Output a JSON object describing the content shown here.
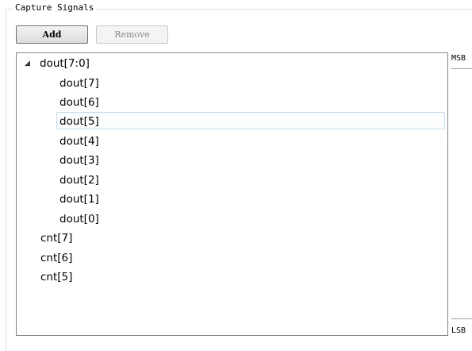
{
  "group": {
    "title": "Capture Signals"
  },
  "buttons": {
    "add": "Add",
    "remove": "Remove"
  },
  "tree": {
    "expander_glyph": "◢",
    "parent": "dout[7:0]",
    "children": [
      "dout[7]",
      "dout[6]",
      "dout[5]",
      "dout[4]",
      "dout[3]",
      "dout[2]",
      "dout[1]",
      "dout[0]"
    ],
    "selected": "dout[5]",
    "siblings": [
      "cnt[7]",
      "cnt[6]",
      "cnt[5]"
    ]
  },
  "axis": {
    "top": "MSB",
    "bottom": "LSB"
  }
}
